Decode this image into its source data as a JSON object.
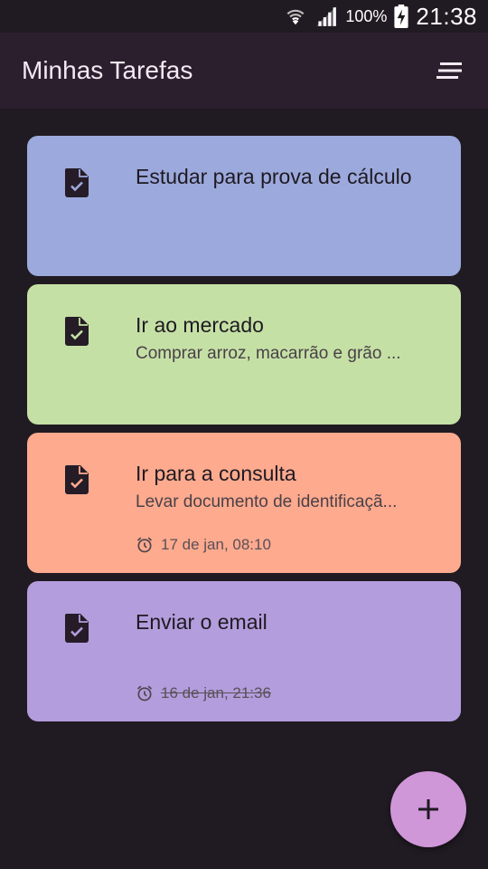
{
  "status_bar": {
    "battery_percent": "100%",
    "time": "21:38",
    "icons": [
      "wifi-icon",
      "signal-icon",
      "battery-charging-icon"
    ]
  },
  "app_bar": {
    "title": "Minhas Tarefas",
    "menu_icon": "sort-menu-icon"
  },
  "tasks": [
    {
      "title": "Estudar para prova de cálculo",
      "description": "",
      "reminder": "",
      "color": "#9ca9dc",
      "icon": "task-document-icon"
    },
    {
      "title": "Ir ao mercado",
      "description": "Comprar arroz, macarrão e grão ...",
      "reminder": "",
      "color": "#c5e0a5",
      "icon": "task-document-icon"
    },
    {
      "title": "Ir para a consulta",
      "description": "Levar documento de identificaçã...",
      "reminder": "17 de jan, 08:10",
      "reminder_expired": false,
      "color": "#fdaa8e",
      "icon": "task-document-icon"
    },
    {
      "title": "Enviar o email",
      "description": "",
      "reminder": "16 de jan, 21:36",
      "reminder_expired": true,
      "color": "#b39ddc",
      "icon": "task-document-icon"
    }
  ],
  "fab": {
    "icon": "plus-icon",
    "color": "#cf96d8"
  }
}
